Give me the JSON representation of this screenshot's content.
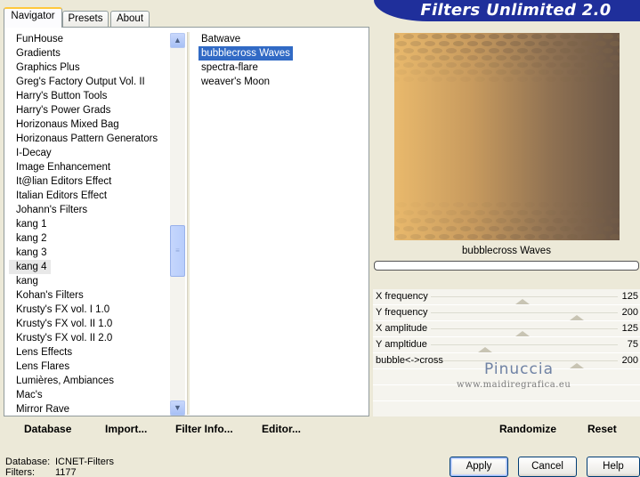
{
  "tabs": [
    {
      "label": "Navigator",
      "active": true
    },
    {
      "label": "Presets",
      "active": false
    },
    {
      "label": "About",
      "active": false
    }
  ],
  "title": "Filters Unlimited 2.0",
  "categories": [
    "FunHouse",
    "Gradients",
    "Graphics Plus",
    "Greg's Factory Output Vol. II",
    "Harry's Button Tools",
    "Harry's Power Grads",
    "Horizonaus Mixed Bag",
    "Horizonaus Pattern Generators",
    "I-Decay",
    "Image Enhancement",
    "It@lian Editors Effect",
    "Italian Editors Effect",
    "Johann's Filters",
    "kang 1",
    "kang 2",
    "kang 3",
    "kang 4",
    "kang",
    "Kohan's Filters",
    "Krusty's FX vol. I 1.0",
    "Krusty's FX vol. II 1.0",
    "Krusty's FX vol. II 2.0",
    "Lens Effects",
    "Lens Flares",
    "Lumières, Ambiances",
    "Mac's",
    "Mirror Rave"
  ],
  "selected_category": "kang 4",
  "filters": [
    "Batwave",
    "bubblecross Waves",
    "spectra-flare",
    "weaver's Moon"
  ],
  "selected_filter": "bubblecross Waves",
  "left_buttons": {
    "database": "Database",
    "import": "Import...",
    "filter_info": "Filter Info...",
    "editor": "Editor..."
  },
  "preview_filter_name": "bubblecross Waves",
  "params": [
    {
      "name": "X frequency",
      "value": "125",
      "level": 0.49
    },
    {
      "name": "Y frequency",
      "value": "200",
      "level": 0.78
    },
    {
      "name": "X amplitude",
      "value": "125",
      "level": 0.49
    },
    {
      "name": "Y ampltidue",
      "value": "75",
      "level": 0.29
    },
    {
      "name": "bubble<->cross",
      "value": "200",
      "level": 0.78
    }
  ],
  "watermark": {
    "name": "Pinuccia",
    "url": "www.maidiregrafica.eu"
  },
  "right_buttons": {
    "randomize": "Randomize",
    "reset": "Reset"
  },
  "status": {
    "database_label": "Database:",
    "database_value": "ICNET-Filters",
    "filters_label": "Filters:",
    "filters_value": "1177"
  },
  "dialog_buttons": {
    "apply": "Apply",
    "cancel": "Cancel",
    "help": "Help"
  },
  "colors": {
    "title_band": "#1f2f9b",
    "selection": "#316ac5",
    "preview_light": "#e9b96c",
    "preview_dark": "#6a5646"
  }
}
